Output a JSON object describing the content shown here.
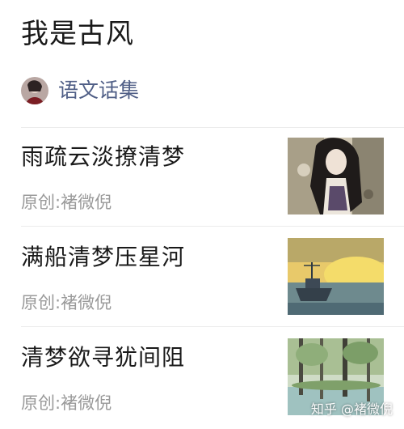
{
  "page": {
    "title": "我是古风"
  },
  "collection": {
    "label": "语文话集",
    "avatar_icon": "portrait-avatar"
  },
  "articles": [
    {
      "title": "雨疏云淡撩清梦",
      "meta": "原创:褚微倪",
      "thumbnail": "ancient-style-girl-illustration"
    },
    {
      "title": "满船清梦压星河",
      "meta": "原创:褚微倪",
      "thumbnail": "boat-on-golden-river-painting"
    },
    {
      "title": "清梦欲寻犹间阻",
      "meta": "原创:褚微倪",
      "thumbnail": "forest-lake-painting"
    }
  ],
  "watermark": "知乎 @褚微倪"
}
